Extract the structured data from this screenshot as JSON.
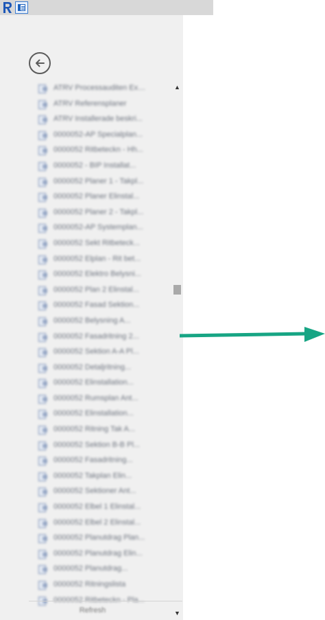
{
  "toolbar": {
    "app_icon": "revit-r-icon",
    "doc_icon": "document-view-icon"
  },
  "panel": {
    "back_icon": "back-arrow-circle-icon",
    "item_icon": "document-icon",
    "items": [
      {
        "label": "ATRV Processauditen Exam..."
      },
      {
        "label": "ATRV Referensplaner"
      },
      {
        "label": "ATRV Installerade beskri..."
      },
      {
        "label": "0000052-AP Specialplan..."
      },
      {
        "label": "0000052 Ritbeteckn - Hh..."
      },
      {
        "label": "0000052 - BIP Installat..."
      },
      {
        "label": "0000052 Planer 1 - Takpl..."
      },
      {
        "label": "0000052 Planer Elinstal..."
      },
      {
        "label": "0000052 Planer 2 - Takpl..."
      },
      {
        "label": "0000052-AP Systemplan..."
      },
      {
        "label": "0000052 Sekt Ritbeteck..."
      },
      {
        "label": "0000052 Elplan - Rit bet..."
      },
      {
        "label": "0000052 Elektro Belysni..."
      },
      {
        "label": "0000052 Plan 2 Elinstal..."
      },
      {
        "label": "0000052 Fasad Sektion..."
      },
      {
        "label": "0000052 Belysning A..."
      },
      {
        "label": "0000052 Fasadritning 2..."
      },
      {
        "label": "0000052 Sektion A-A Pl..."
      },
      {
        "label": "0000052 Detaljritning..."
      },
      {
        "label": "0000052 Elinstallation..."
      },
      {
        "label": "0000052 Rumsplan Ant..."
      },
      {
        "label": "0000052 Elinstallation..."
      },
      {
        "label": "0000052 Ritning Tak A..."
      },
      {
        "label": "0000052 Sektion B-B Pl..."
      },
      {
        "label": "0000052 Fasadritning..."
      },
      {
        "label": "0000052 Takplan Elin..."
      },
      {
        "label": "0000052 Sektioner Ant..."
      },
      {
        "label": "0000052 Elbel 1 Elinstal..."
      },
      {
        "label": "0000052 Elbel 2 Elinstal..."
      },
      {
        "label": "0000052 Planutdrag Plan..."
      },
      {
        "label": "0000052 Planutdrag Elin..."
      },
      {
        "label": "0000052 Planutdrag..."
      },
      {
        "label": "0000052 Ritningslista"
      },
      {
        "label": "0000052 Ritbeteckn - Pla..."
      }
    ],
    "refresh_label": "Refresh"
  },
  "scrollbar": {
    "up_glyph": "▲",
    "down_glyph": "▼",
    "position": 0.38
  },
  "colors": {
    "accent_arrow": "#17a584",
    "panel_bg": "#f0f0f0",
    "topbar_bg": "#d8d8d8"
  }
}
